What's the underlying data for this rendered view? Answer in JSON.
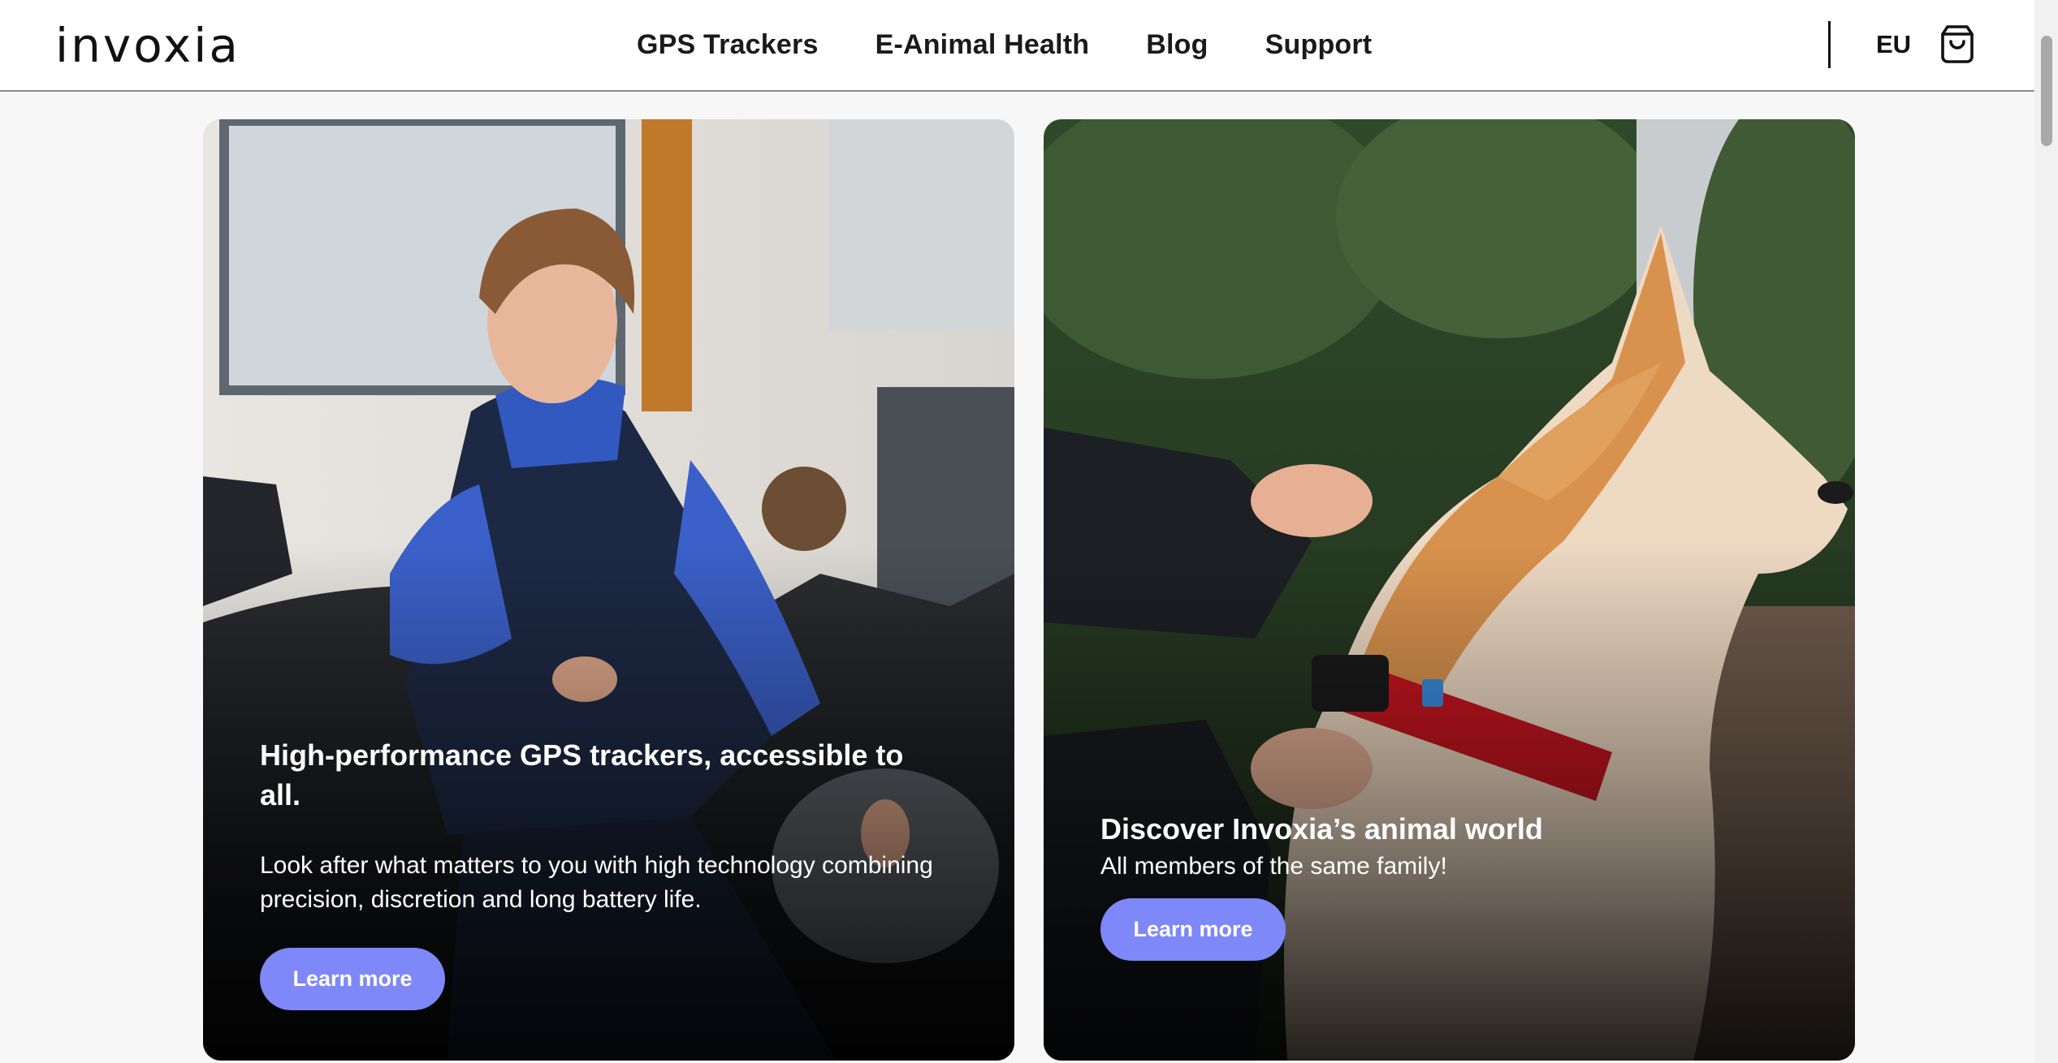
{
  "header": {
    "logo_text": "invoxia",
    "nav": [
      {
        "label": "GPS Trackers"
      },
      {
        "label": "E-Animal Health"
      },
      {
        "label": "Blog"
      },
      {
        "label": "Support"
      }
    ],
    "region": "EU",
    "cart_icon": "shopping-bag-icon"
  },
  "cards": [
    {
      "title": "High-performance GPS trackers, accessible to all.",
      "text": "Look after what matters to you with high technology combining precision, discretion and long battery life.",
      "button": "Learn more"
    },
    {
      "title": "Discover Invoxia’s animal world",
      "text": "All members of the same family!",
      "button": "Learn more"
    }
  ],
  "colors": {
    "accent_button": "#7f88f8",
    "header_bg": "#ffffff",
    "page_bg": "#f7f7f8"
  }
}
